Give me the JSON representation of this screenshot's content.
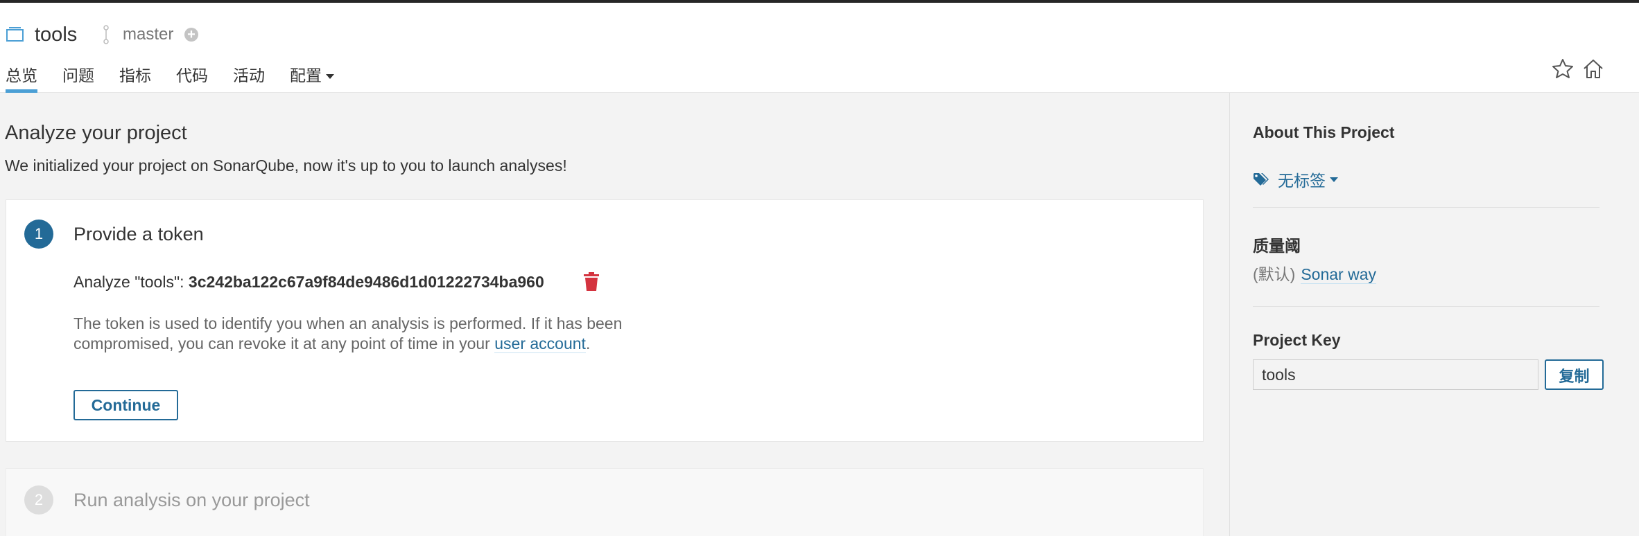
{
  "header": {
    "project_name": "tools",
    "branch": "master",
    "nav": [
      "总览",
      "问题",
      "指标",
      "代码",
      "活动",
      "配置"
    ]
  },
  "main": {
    "title": "Analyze your project",
    "subtitle": "We initialized your project on SonarQube, now it's up to you to launch analyses!",
    "step1": {
      "number": "1",
      "title": "Provide a token",
      "token_label": "Analyze \"tools\": ",
      "token_value": "3c242ba122c67a9f84de9486d1d01222734ba960",
      "desc_text": "The token is used to identify you when an analysis is performed. If it has been compromised, you can revoke it at any point of time in your ",
      "desc_link": "user account",
      "desc_end": ".",
      "continue_label": "Continue"
    },
    "step2": {
      "number": "2",
      "title": "Run analysis on your project"
    }
  },
  "sidebar": {
    "about_title": "About This Project",
    "tags_label": "无标签",
    "quality_gate_title": "质量阈",
    "quality_gate_default": "(默认)",
    "quality_gate_name": "Sonar way",
    "project_key_title": "Project Key",
    "project_key_value": "tools",
    "copy_label": "复制"
  },
  "colors": {
    "accent": "#236a97",
    "tab_underline": "#4b9fd5",
    "trash": "#d4333f",
    "background": "#f3f3f3"
  },
  "icons": [
    "project-icon",
    "branch-icon",
    "add-circle-icon",
    "star-icon",
    "home-icon",
    "trash-icon",
    "tags-icon"
  ]
}
